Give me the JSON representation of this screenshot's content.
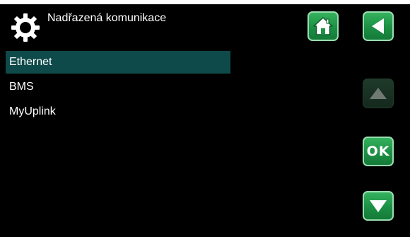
{
  "header": {
    "title": "Nadřazená komunikace",
    "settings_icon": "gear-icon"
  },
  "menu": {
    "items": [
      {
        "label": "Ethernet",
        "selected": true
      },
      {
        "label": "BMS",
        "selected": false
      },
      {
        "label": "MyUplink",
        "selected": false
      }
    ]
  },
  "buttons": {
    "home": {
      "icon": "house-icon",
      "enabled": true
    },
    "back": {
      "icon": "arrow-left-icon",
      "enabled": true
    },
    "up": {
      "icon": "arrow-up-icon",
      "enabled": false
    },
    "ok": {
      "label": "OK",
      "enabled": true
    },
    "down": {
      "icon": "arrow-down-icon",
      "enabled": true
    }
  },
  "colors": {
    "background": "#000000",
    "selected_row": "#0e4a4a",
    "button_green": "#1e9246",
    "button_disabled": "#1a3324",
    "text": "#ffffff"
  }
}
